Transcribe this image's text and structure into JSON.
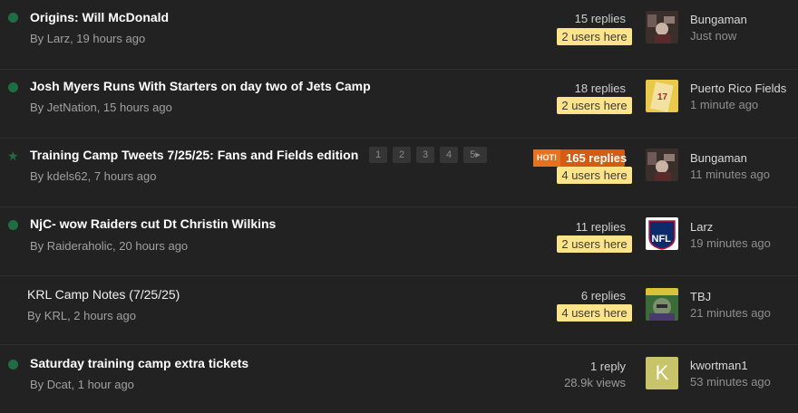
{
  "threads": [
    {
      "title": "Origins: Will McDonald",
      "byline": "By Larz, 19 hours ago",
      "replies": "15 replies",
      "users": "2 users here",
      "last_user": "Bungaman",
      "last_time": "Just now",
      "avatar": "photo-avatar"
    },
    {
      "title": "Josh Myers Runs With Starters on day two of Jets Camp",
      "byline": "By JetNation, 15 hours ago",
      "replies": "18 replies",
      "users": "2 users here",
      "last_user": "Puerto Rico Fields",
      "last_time": "1 minute ago",
      "avatar": "jersey-avatar"
    },
    {
      "title": "Training Camp Tweets 7/25/25: Fans and Fields edition",
      "byline": "By kdels62, 7 hours ago",
      "hot_label": "HOT!",
      "replies": "165 replies",
      "users": "4 users here",
      "last_user": "Bungaman",
      "last_time": "11 minutes ago",
      "pages": [
        "1",
        "2",
        "3",
        "4",
        "5"
      ],
      "avatar": "photo-avatar"
    },
    {
      "title": "NjC- wow Raiders cut Dt Christin Wilkins",
      "byline": "By Raideraholic, 20 hours ago",
      "replies": "11 replies",
      "users": "2 users here",
      "last_user": "Larz",
      "last_time": "19 minutes ago",
      "avatar": "nfl-shield-avatar",
      "avatar_text": "NFL"
    },
    {
      "title": "KRL Camp Notes (7/25/25)",
      "byline": "By KRL, 2 hours ago",
      "replies": "6 replies",
      "users": "4 users here",
      "last_user": "TBJ",
      "last_time": "21 minutes ago",
      "avatar": "comic-avatar"
    },
    {
      "title": "Saturday training camp extra tickets",
      "byline": "By Dcat, 1 hour ago",
      "replies": "1 reply",
      "views": "28.9k views",
      "last_user": "kwortman1",
      "last_time": "53 minutes ago",
      "avatar": "letter-avatar",
      "avatar_letter": "K"
    }
  ],
  "colors": {
    "unread_marker": "#1f6e43",
    "users_badge": "#fde38a",
    "hot_badge": "#d35b12",
    "background": "#222222"
  }
}
